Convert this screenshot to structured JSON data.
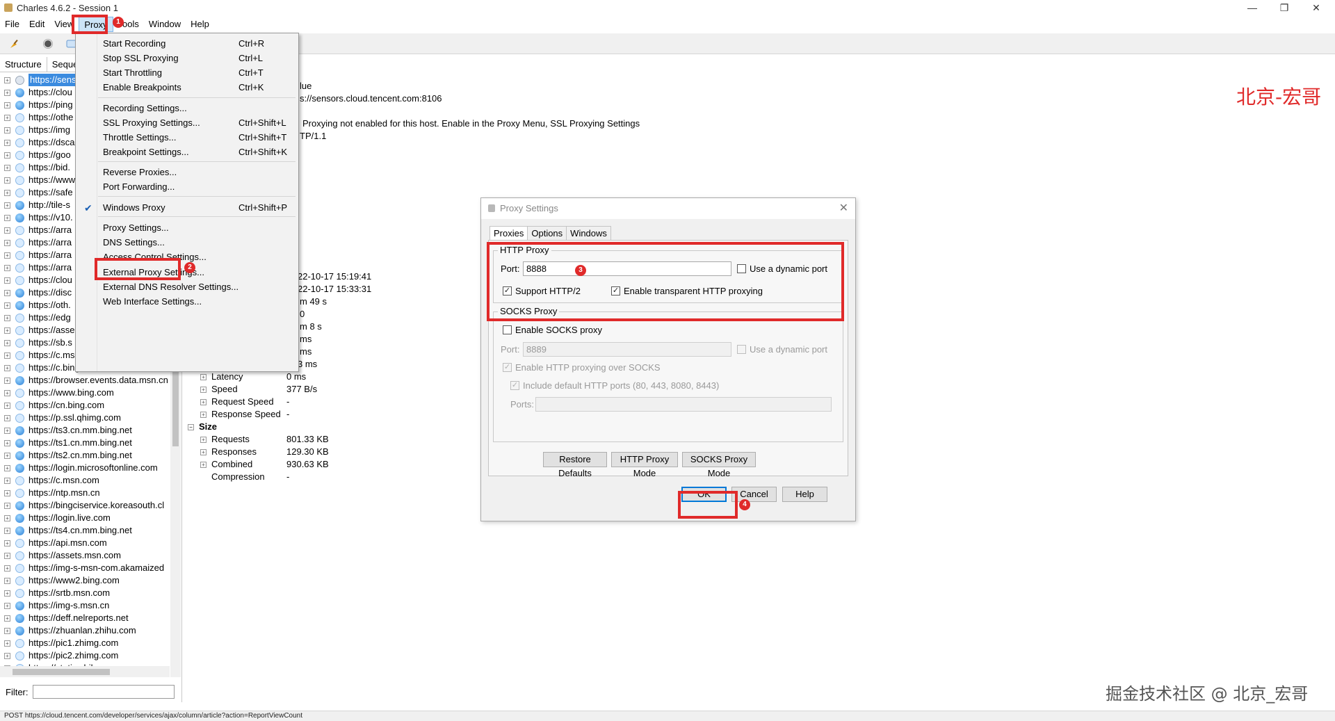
{
  "window": {
    "title": "Charles 4.6.2 - Session 1",
    "minimize": "—",
    "maximize": "❐",
    "close": "✕"
  },
  "menubar": [
    "File",
    "Edit",
    "View",
    "Proxy",
    "Tools",
    "Window",
    "Help"
  ],
  "left_panel": {
    "tabs": [
      "Structure",
      "Sequence"
    ],
    "hosts": [
      {
        "label": "https://sens",
        "icon": "lock",
        "selected": true
      },
      {
        "label": "https://clou",
        "icon": "globe"
      },
      {
        "label": "https://ping",
        "icon": "globe"
      },
      {
        "label": "https://othe",
        "icon": "bolt"
      },
      {
        "label": "https://img",
        "icon": "bolt"
      },
      {
        "label": "https://dsca",
        "icon": "bolt"
      },
      {
        "label": "https://goo",
        "icon": "bolt"
      },
      {
        "label": "https://bid.",
        "icon": "bolt"
      },
      {
        "label": "https://www",
        "icon": "bolt"
      },
      {
        "label": "https://safe",
        "icon": "bolt"
      },
      {
        "label": "http://tile-s",
        "icon": "globe"
      },
      {
        "label": "https://v10.",
        "icon": "globe"
      },
      {
        "label": "https://arra",
        "icon": "bolt"
      },
      {
        "label": "https://arra",
        "icon": "bolt"
      },
      {
        "label": "https://arra",
        "icon": "bolt"
      },
      {
        "label": "https://arra",
        "icon": "bolt"
      },
      {
        "label": "https://clou",
        "icon": "bolt"
      },
      {
        "label": "https://disc",
        "icon": "globe"
      },
      {
        "label": "https://oth.",
        "icon": "globe"
      },
      {
        "label": "https://edg",
        "icon": "bolt"
      },
      {
        "label": "https://asse",
        "icon": "bolt"
      },
      {
        "label": "https://sb.s",
        "icon": "bolt"
      },
      {
        "label": "https://c.ms",
        "icon": "bolt"
      },
      {
        "label": "https://c.bing.com",
        "icon": "bolt"
      },
      {
        "label": "https://browser.events.data.msn.cn",
        "icon": "globe"
      },
      {
        "label": "https://www.bing.com",
        "icon": "bolt"
      },
      {
        "label": "https://cn.bing.com",
        "icon": "bolt"
      },
      {
        "label": "https://p.ssl.qhimg.com",
        "icon": "bolt"
      },
      {
        "label": "https://ts3.cn.mm.bing.net",
        "icon": "globe"
      },
      {
        "label": "https://ts1.cn.mm.bing.net",
        "icon": "globe"
      },
      {
        "label": "https://ts2.cn.mm.bing.net",
        "icon": "globe"
      },
      {
        "label": "https://login.microsoftonline.com",
        "icon": "globe"
      },
      {
        "label": "https://c.msn.com",
        "icon": "bolt"
      },
      {
        "label": "https://ntp.msn.cn",
        "icon": "bolt"
      },
      {
        "label": "https://bingciservice.koreasouth.cl",
        "icon": "globe"
      },
      {
        "label": "https://login.live.com",
        "icon": "globe"
      },
      {
        "label": "https://ts4.cn.mm.bing.net",
        "icon": "globe"
      },
      {
        "label": "https://api.msn.com",
        "icon": "bolt"
      },
      {
        "label": "https://assets.msn.com",
        "icon": "bolt"
      },
      {
        "label": "https://img-s-msn-com.akamaized",
        "icon": "bolt"
      },
      {
        "label": "https://www2.bing.com",
        "icon": "bolt"
      },
      {
        "label": "https://srtb.msn.com",
        "icon": "bolt"
      },
      {
        "label": "https://img-s.msn.cn",
        "icon": "globe"
      },
      {
        "label": "https://deff.nelreports.net",
        "icon": "globe"
      },
      {
        "label": "https://zhuanlan.zhihu.com",
        "icon": "globe"
      },
      {
        "label": "https://pic1.zhimg.com",
        "icon": "bolt"
      },
      {
        "label": "https://pic2.zhimg.com",
        "icon": "bolt"
      },
      {
        "label": "https://static.zhihu.com",
        "icon": "bolt"
      }
    ],
    "filter_label": "Filter:"
  },
  "right_panel": {
    "lines": [
      {
        "text": "lue"
      },
      {
        "text": "s://sensors.cloud.tencent.com:8106"
      },
      {
        "text": "Proxying not enabled for this host. Enable in the Proxy Menu, SSL Proxying Settings"
      },
      {
        "text": "TP/1.1"
      },
      {
        "text": "22-10-17 15:19:41"
      },
      {
        "text": "22-10-17 15:33:31"
      },
      {
        "text": "m 49 s"
      },
      {
        "text": "0"
      },
      {
        "text": "m 8 s"
      },
      {
        "text": "ms"
      },
      {
        "text": "ms"
      },
      {
        "text": "3 ms"
      }
    ],
    "timing_rows": [
      {
        "label": "Latency",
        "value": "0 ms"
      },
      {
        "label": "Speed",
        "value": "377 B/s"
      },
      {
        "label": "Request Speed",
        "value": "-"
      },
      {
        "label": "Response Speed",
        "value": "-"
      }
    ],
    "size_header": "Size",
    "size_rows": [
      {
        "label": "Requests",
        "value": "801.33 KB"
      },
      {
        "label": "Responses",
        "value": "129.30 KB"
      },
      {
        "label": "Combined",
        "value": "930.63 KB"
      },
      {
        "label": "Compression",
        "value": "-"
      }
    ]
  },
  "proxy_menu": {
    "items": [
      {
        "label": "Start Recording",
        "shortcut": "Ctrl+R"
      },
      {
        "label": "Stop SSL Proxying",
        "shortcut": "Ctrl+L"
      },
      {
        "label": "Start Throttling",
        "shortcut": "Ctrl+T"
      },
      {
        "label": "Enable Breakpoints",
        "shortcut": "Ctrl+K"
      },
      {
        "label": "Recording Settings...",
        "shortcut": ""
      },
      {
        "label": "SSL Proxying Settings...",
        "shortcut": "Ctrl+Shift+L"
      },
      {
        "label": "Throttle Settings...",
        "shortcut": "Ctrl+Shift+T"
      },
      {
        "label": "Breakpoint Settings...",
        "shortcut": "Ctrl+Shift+K"
      },
      {
        "label": "Reverse Proxies...",
        "shortcut": ""
      },
      {
        "label": "Port Forwarding...",
        "shortcut": ""
      },
      {
        "label": "Windows Proxy",
        "shortcut": "Ctrl+Shift+P",
        "checked": true
      },
      {
        "label": "Proxy Settings...",
        "shortcut": ""
      },
      {
        "label": "DNS Settings...",
        "shortcut": ""
      },
      {
        "label": "Access Control Settings...",
        "shortcut": ""
      },
      {
        "label": "External Proxy Settings...",
        "shortcut": ""
      },
      {
        "label": "External DNS Resolver Settings...",
        "shortcut": ""
      },
      {
        "label": "Web Interface Settings...",
        "shortcut": ""
      }
    ]
  },
  "dialog": {
    "title": "Proxy Settings",
    "tabs": [
      "Proxies",
      "Options",
      "Windows"
    ],
    "http_proxy": {
      "title": "HTTP Proxy",
      "port_label": "Port:",
      "port_value": "8888",
      "dynamic_port_label": "Use a dynamic port",
      "dynamic_port_checked": false,
      "http2_label": "Support HTTP/2",
      "http2_checked": true,
      "transparent_label": "Enable transparent HTTP proxying",
      "transparent_checked": true
    },
    "socks_proxy": {
      "title": "SOCKS Proxy",
      "enable_label": "Enable SOCKS proxy",
      "enable_checked": false,
      "port_label": "Port:",
      "port_value": "8889",
      "dynamic_port_label": "Use a dynamic port",
      "http_over_socks_label": "Enable HTTP proxying over SOCKS",
      "include_ports_label": "Include default HTTP ports (80, 443, 8080, 8443)",
      "ports_label": "Ports:"
    },
    "buttons": {
      "restore": "Restore Defaults",
      "http_mode": "HTTP Proxy Mode",
      "socks_mode": "SOCKS Proxy Mode",
      "ok": "OK",
      "cancel": "Cancel",
      "help": "Help"
    }
  },
  "annotations": {
    "badges": [
      "1",
      "2",
      "3",
      "4"
    ],
    "watermark_top": "北京-宏哥",
    "watermark_bottom": "掘金技术社区 @ 北京_宏哥",
    "color": "#e02a2a"
  },
  "status_bar": "POST https://cloud.tencent.com/developer/services/ajax/column/article?action=ReportViewCount"
}
